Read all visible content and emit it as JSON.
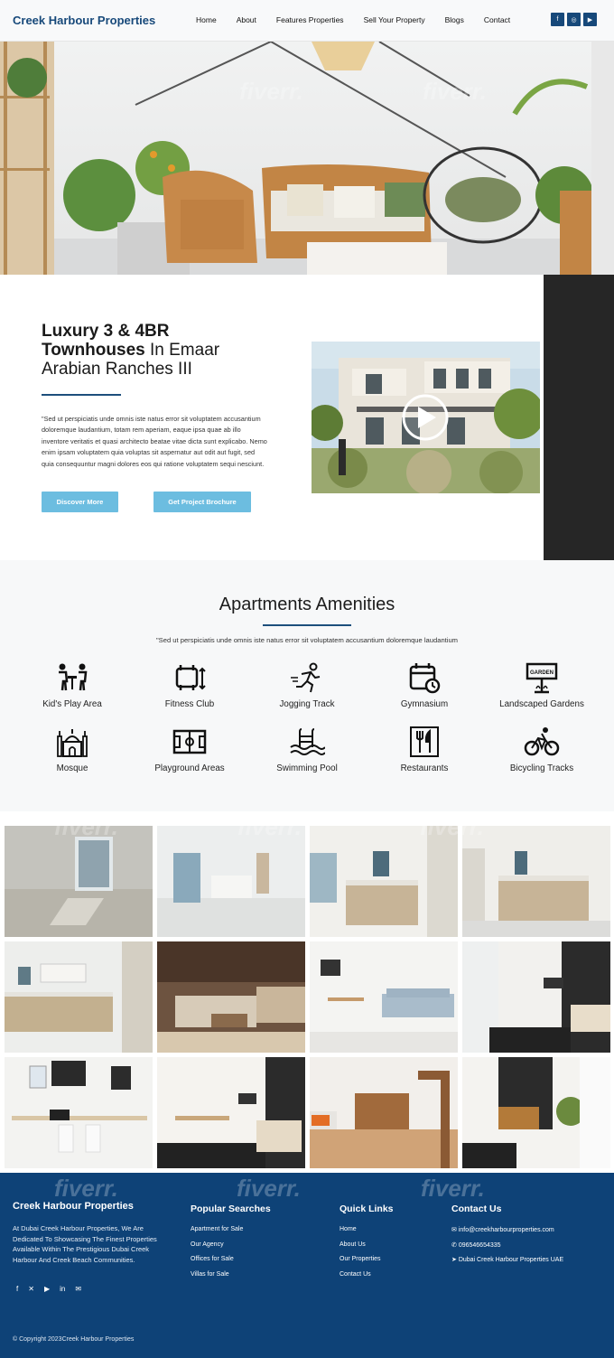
{
  "nav": {
    "brand": "Creek Harbour Properties",
    "items": [
      "Home",
      "About",
      "Features Properties",
      "Sell Your Property",
      "Blogs",
      "Contact"
    ],
    "social": [
      "facebook-icon",
      "instagram-icon",
      "youtube-icon"
    ]
  },
  "intro": {
    "title_bold": "Luxury 3 & 4BR Townhouses",
    "title_rest": " In Emaar Arabian Ranches III",
    "paragraph": "\"Sed ut perspiciatis unde omnis iste natus error sit voluptatem accusantium doloremque laudantium, totam rem aperiam, eaque ipsa quae ab illo inventore veritatis et quasi architecto beatae vitae dicta sunt explicabo. Nemo enim ipsam voluptatem quia voluptas sit aspernatur aut odit aut fugit, sed quia consequuntur magni dolores eos qui ratione voluptatem sequi nesciunt.",
    "btn_discover": "Discover More",
    "btn_brochure": "Get Project Brochure"
  },
  "amenities": {
    "title": "Apartments Amenities",
    "subtitle": "\"Sed ut perspiciatis unde omnis iste natus error sit voluptatem accusantium doloremque laudantium",
    "items": [
      {
        "label": "Kid's Play Area",
        "icon": "kids-play-icon"
      },
      {
        "label": "Fitness Club",
        "icon": "fitness-icon"
      },
      {
        "label": "Jogging Track",
        "icon": "jogging-icon"
      },
      {
        "label": "Gymnasium",
        "icon": "gymnasium-icon"
      },
      {
        "label": "Landscaped Gardens",
        "icon": "garden-sign-icon"
      },
      {
        "label": "Mosque",
        "icon": "mosque-icon"
      },
      {
        "label": "Playground Areas",
        "icon": "playground-icon"
      },
      {
        "label": "Swimming Pool",
        "icon": "pool-icon"
      },
      {
        "label": "Restaurants",
        "icon": "restaurant-icon"
      },
      {
        "label": "Bicycling Tracks",
        "icon": "bicycle-icon"
      }
    ],
    "garden_sign_text": "GARDEN"
  },
  "footer": {
    "brand": "Creek Harbour Properties",
    "about": "At Dubai Creek Harbour Properties, We Are Dedicated To Showcasing The Finest Properties Available Within The Prestigious Dubai Creek Harbour And Creek Beach Communities.",
    "popular_title": "Popular Searches",
    "popular": [
      "Apartment for Sale",
      "Our Agency",
      "Offices for Sale",
      "Villas for Sale"
    ],
    "quick_title": "Quick Links",
    "quick": [
      "Home",
      "About Us",
      "Our Properties",
      "Contact Us"
    ],
    "contact_title": "Contact Us",
    "email": "info@creekharbourproperties.com",
    "phone": "096546654335",
    "location": "Dubai Creek Harbour Properties UAE",
    "copyright": "© Copyright 2023Creek Harbour Properties",
    "social": [
      "facebook-icon",
      "twitter-icon",
      "youtube-icon",
      "linkedin-icon",
      "email-icon"
    ]
  },
  "watermark": "fiverr."
}
